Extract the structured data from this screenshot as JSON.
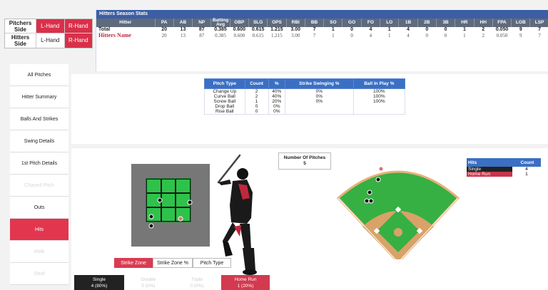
{
  "filters": {
    "pitchers_side": {
      "label": "Pitchers Side",
      "left": "L-Hand",
      "right": "R-Hand"
    },
    "hitters_side": {
      "label": "Hitters Side",
      "left": "L-Hand",
      "right": "R-Hand"
    }
  },
  "stats": {
    "title": "Hitters Season Stats",
    "columns": [
      "Hitter",
      "PA",
      "AB",
      "NP",
      "Batting Avg",
      "OBP",
      "SLG",
      "OPS",
      "RBI",
      "BB",
      "SO",
      "GO",
      "FO",
      "LO",
      "1B",
      "2B",
      "3B",
      "HR",
      "HH",
      "FPA",
      "LOB",
      "LSP"
    ],
    "rows": [
      [
        "Total",
        "20",
        "13",
        "87",
        "0.385",
        "0.600",
        "0.615",
        "1.215",
        "3.00",
        "7",
        "1",
        "0",
        "4",
        "1",
        "4",
        "0",
        "0",
        "1",
        "2",
        "0.050",
        "9",
        "7"
      ],
      [
        "Hitters Name",
        "20",
        "13",
        "87",
        "0.385",
        "0.600",
        "0.615",
        "1.215",
        "3.00",
        "7",
        "1",
        "0",
        "4",
        "1",
        "4",
        "0",
        "0",
        "1",
        "2",
        "0.050",
        "9",
        "7"
      ]
    ]
  },
  "nav": {
    "items": [
      {
        "label": "All Pitches",
        "state": "normal"
      },
      {
        "label": "Hitter Summary",
        "state": "normal"
      },
      {
        "label": "Balls And Strikes",
        "state": "normal"
      },
      {
        "label": "Swing Details",
        "state": "normal"
      },
      {
        "label": "1st Pitch Details",
        "state": "normal"
      },
      {
        "label": "Chased Pitch",
        "state": "disabled"
      },
      {
        "label": "Outs",
        "state": "normal"
      },
      {
        "label": "Hits",
        "state": "active"
      },
      {
        "label": "Walk",
        "state": "disabled"
      },
      {
        "label": "Steal",
        "state": "disabled"
      }
    ]
  },
  "pitch_types": {
    "columns": [
      "Pitch Type",
      "Count",
      "%",
      "Strike Swinging %",
      "Ball In Play %"
    ],
    "rows": [
      [
        "Change Up",
        "2",
        "40%",
        "0%",
        "100%"
      ],
      [
        "Curve Ball",
        "2",
        "40%",
        "0%",
        "100%"
      ],
      [
        "Screw Ball",
        "1",
        "20%",
        "0%",
        "100%"
      ],
      [
        "Drop Ball",
        "0",
        "0%",
        "",
        ""
      ],
      [
        "Rise Ball",
        "0",
        "0%",
        "",
        ""
      ]
    ]
  },
  "zone": {
    "tabs": [
      "Strike Zone",
      "Strike Zone %",
      "Pitch Type"
    ],
    "active_tab": "Strike Zone",
    "results": [
      {
        "label": "Single",
        "value": "4 (80%)",
        "style": "black"
      },
      {
        "label": "Double",
        "value": "0 (0%)",
        "style": "muted"
      },
      {
        "label": "Triple",
        "value": "0 (0%)",
        "style": "muted"
      },
      {
        "label": "Home Run",
        "value": "1 (20%)",
        "style": "red"
      }
    ]
  },
  "number_of_pitches": {
    "label": "Number Of Pitches",
    "value": "5"
  },
  "hits_table": {
    "columns": [
      "Hits",
      "Count"
    ],
    "rows": [
      {
        "label": "Single",
        "count": "4"
      },
      {
        "label": "Home Run",
        "count": "1"
      }
    ]
  },
  "colors": {
    "accent_red": "#d9304a",
    "header_blue": "#3b5ea5",
    "table_blue": "#3a6fc4",
    "field_green": "#36b043",
    "zone_green": "#2ec24a"
  }
}
